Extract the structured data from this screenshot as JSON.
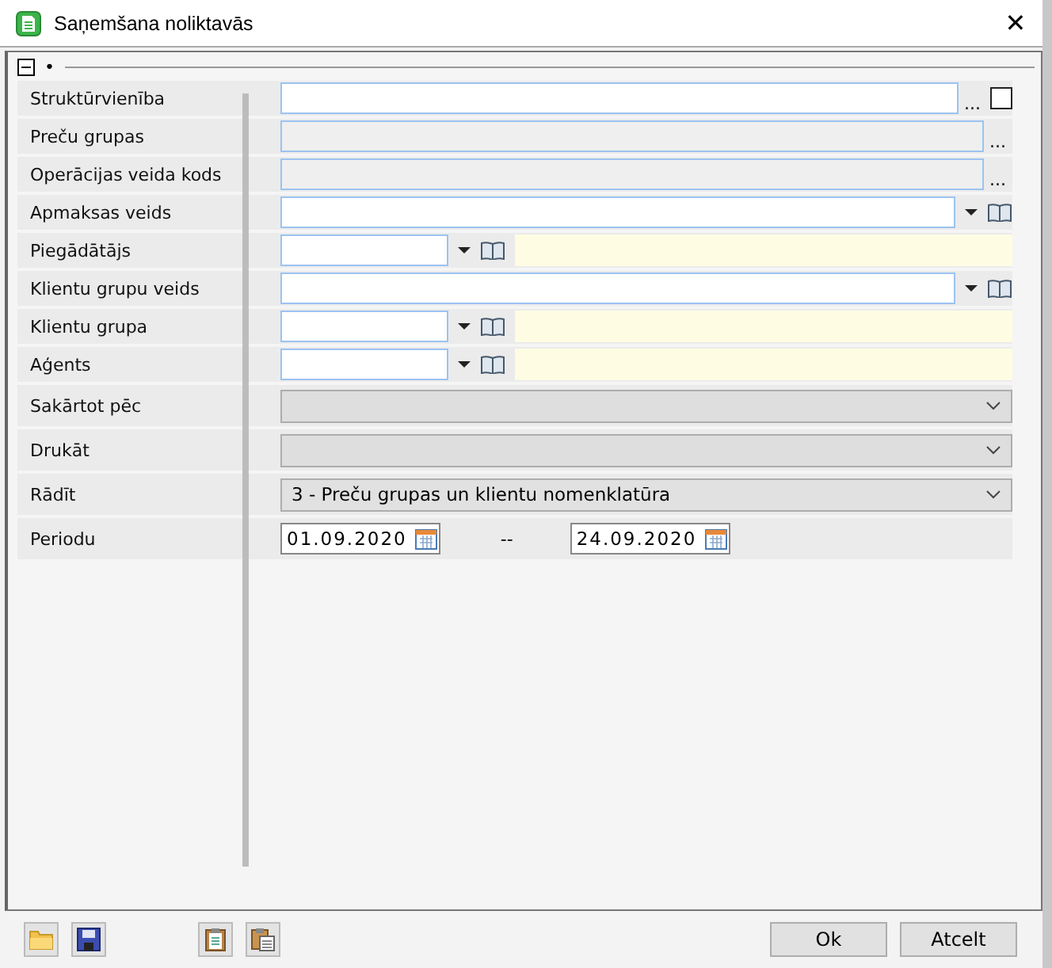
{
  "window": {
    "title": "Saņemšana noliktavās",
    "close": "✕"
  },
  "group": {
    "expanded": true,
    "bullet": "•"
  },
  "rows": [
    {
      "kind": "text_dots",
      "label": "Struktūrvienība",
      "dots": "...",
      "checked": false
    },
    {
      "kind": "disabled_dots",
      "label": "Preču grupas",
      "dots": "..."
    },
    {
      "kind": "disabled_dots",
      "label": "Operācijas veida kods",
      "dots": "..."
    },
    {
      "kind": "combo_book",
      "label": "Apmaksas veids"
    },
    {
      "kind": "lookup",
      "label": "Piegādātājs"
    },
    {
      "kind": "combo_book",
      "label": "Klientu grupu veids"
    },
    {
      "kind": "lookup",
      "label": "Klientu grupa"
    },
    {
      "kind": "lookup",
      "label": "Aģents"
    },
    {
      "kind": "select",
      "label": "Sakārtot pēc",
      "disabled": true
    },
    {
      "kind": "select",
      "label": "Drukāt",
      "disabled": true
    },
    {
      "kind": "select",
      "label": "Rādīt",
      "disabled": false,
      "value": "3 - Preču grupas un klientu nomenklatūra"
    },
    {
      "kind": "date_range",
      "label": "Periodu",
      "from": "01.09.2020",
      "separator": "--",
      "to": "24.09.2020"
    }
  ],
  "buttons": [
    "Ok",
    "Atcelt"
  ]
}
